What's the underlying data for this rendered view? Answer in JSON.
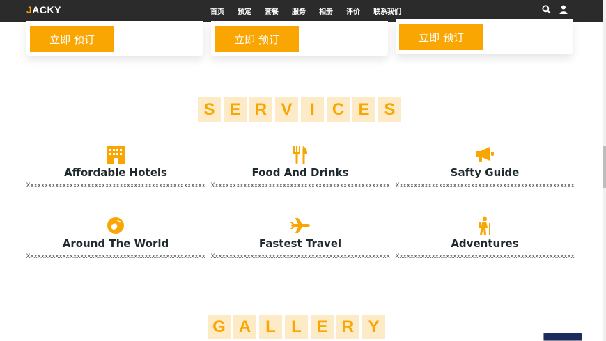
{
  "brand": {
    "first_letter": "J",
    "rest": "ACKY"
  },
  "nav": {
    "items": [
      "首页",
      "预定",
      "套餐",
      "服务",
      "相册",
      "评价",
      "联系我们"
    ],
    "search_icon": "search-icon",
    "user_icon": "user-icon"
  },
  "cards": [
    {
      "button_label": "立即 预订"
    },
    {
      "button_label": "立即 预订"
    },
    {
      "button_label": "立即 预订"
    }
  ],
  "services_title": [
    "S",
    "E",
    "R",
    "V",
    "I",
    "C",
    "E",
    "S"
  ],
  "services": [
    {
      "icon": "hotel-icon",
      "title": "Affordable Hotels",
      "desc": "Xxxxxxxxxxxxxxxxxxxxxxxxxxxxxxxxxxxxxxxxxxxxxxxxxx"
    },
    {
      "icon": "utensils-icon",
      "title": "Food And Drinks",
      "desc": "Xxxxxxxxxxxxxxxxxxxxxxxxxxxxxxxxxxxxxxxxxxxxxxxxxx"
    },
    {
      "icon": "bullhorn-icon",
      "title": "Safty Guide",
      "desc": "Xxxxxxxxxxxxxxxxxxxxxxxxxxxxxxxxxxxxxxxxxxxxxxxxxx"
    },
    {
      "icon": "globe-icon",
      "title": "Around The World",
      "desc": "Xxxxxxxxxxxxxxxxxxxxxxxxxxxxxxxxxxxxxxxxxxxxxxxxxx"
    },
    {
      "icon": "plane-icon",
      "title": "Fastest Travel",
      "desc": "Xxxxxxxxxxxxxxxxxxxxxxxxxxxxxxxxxxxxxxxxxxxxxxxxxx"
    },
    {
      "icon": "hiking-icon",
      "title": "Adventures",
      "desc": "Xxxxxxxxxxxxxxxxxxxxxxxxxxxxxxxxxxxxxxxxxxxxxxxxxx"
    }
  ],
  "gallery_title": [
    "G",
    "A",
    "L",
    "L",
    "E",
    "R",
    "Y"
  ],
  "colors": {
    "accent": "#f9a602",
    "accent_light": "#fdebc8",
    "nav_bg": "#2b2b2b",
    "text_dark": "#1f2a2e"
  }
}
